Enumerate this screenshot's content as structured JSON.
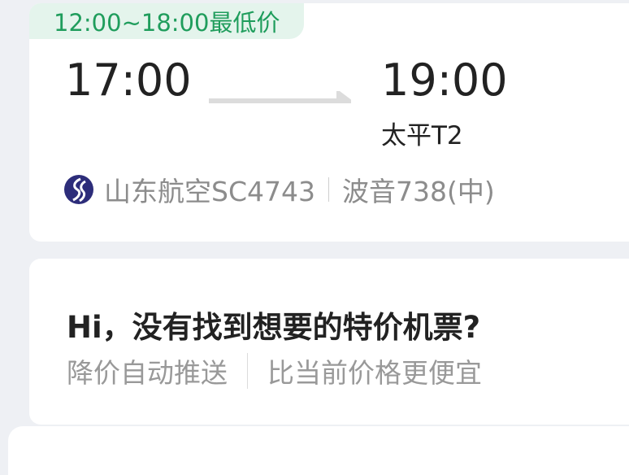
{
  "flight": {
    "price_tag": "12:00~18:00最低价",
    "departure_time": "17:00",
    "arrival_time": "19:00",
    "arrival_terminal": "太平T2",
    "airline_logo": "shandong-airlines-logo",
    "airline_flight": "山东航空SC4743",
    "aircraft": "波音738(中)",
    "accent_color": "#1f9d5c",
    "logo_color": "#2d2d7a"
  },
  "promo": {
    "title": "Hi，没有找到想要的特价机票?",
    "feature_1": "降价自动推送",
    "feature_2": "比当前价格更便宜"
  }
}
